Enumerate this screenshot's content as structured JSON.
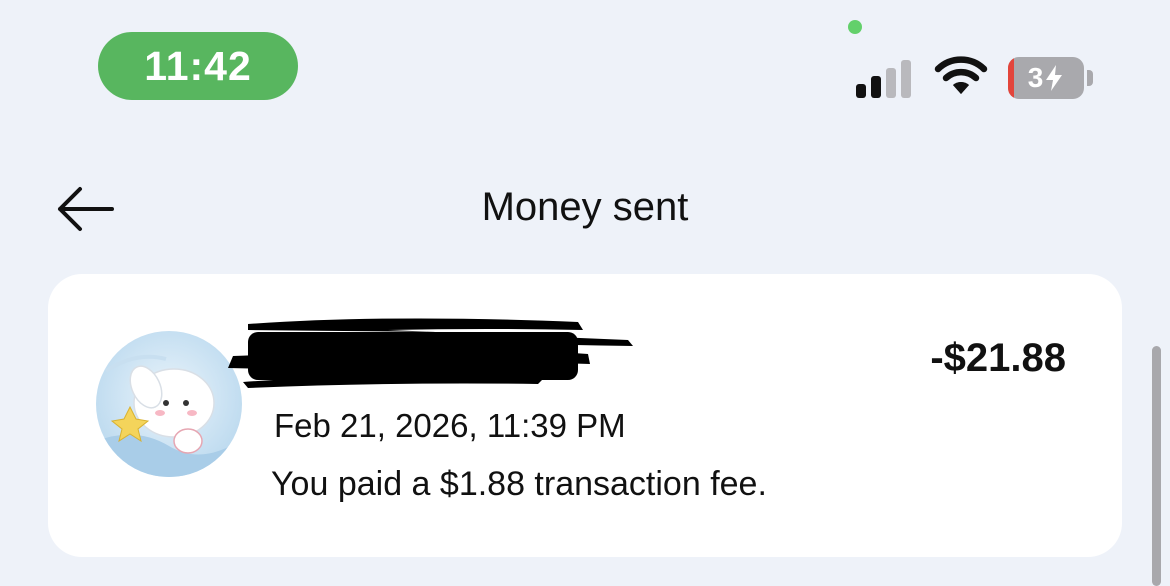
{
  "status_bar": {
    "time": "11:42",
    "battery_level": "34",
    "battery_label": "3",
    "charging": true,
    "signal_bars_active": 2,
    "colors": {
      "time_pill": "#58b65f",
      "battery_low": "#e3453b"
    }
  },
  "header": {
    "title": "Money sent",
    "back_icon": "arrow-left-icon"
  },
  "transaction": {
    "amount": "-$21.88",
    "date": "Feb 21, 2026, 11:39 PM",
    "note": "You paid a $1.88 transaction fee."
  }
}
